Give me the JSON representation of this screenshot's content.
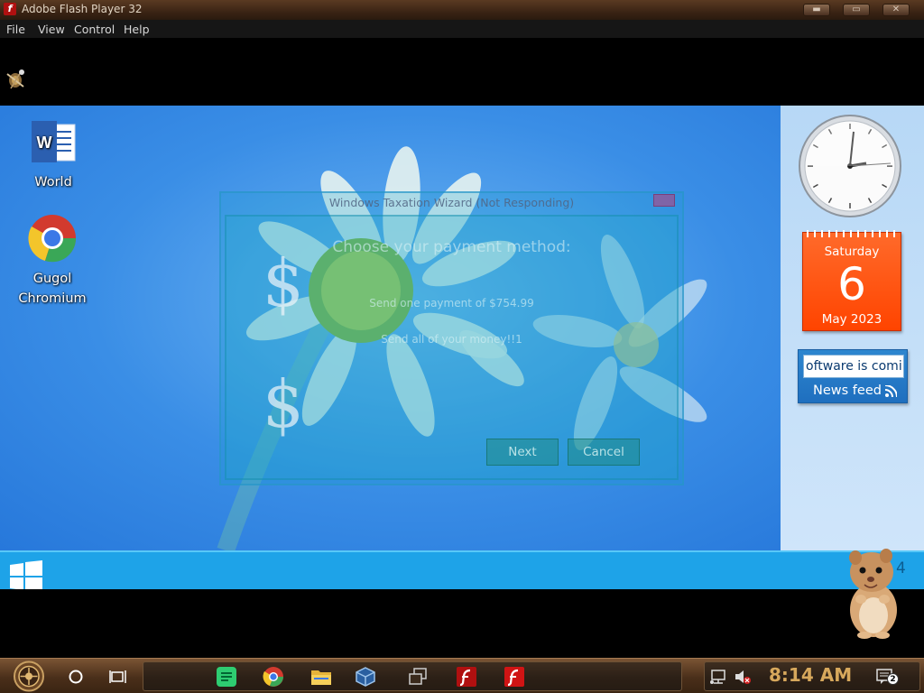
{
  "window": {
    "title": "Adobe Flash Player 32"
  },
  "menu": {
    "file": "File",
    "view": "View",
    "control": "Control",
    "help": "Help"
  },
  "desktop_icons": [
    {
      "label": "World",
      "icon": "word-document-icon"
    },
    {
      "label": "Gugol",
      "label2": "Chromium",
      "icon": "chromium-icon"
    }
  ],
  "wizard": {
    "title": "Windows Taxation Wizard (Not Responding)",
    "heading": "Choose your payment method:",
    "option1": "Send one payment of $754.99",
    "option2": "Send all of your money!!1",
    "symbol": "$",
    "next_label": "Next",
    "cancel_label": "Cancel"
  },
  "gadgets": {
    "calendar": {
      "day": "Saturday",
      "date": "6",
      "month": "May 2023"
    },
    "newsfeed": {
      "ticker": "oftware is comi",
      "label": "News feed"
    }
  },
  "strip": {
    "number": "4"
  },
  "taskbar": {
    "time": "8:14 AM",
    "notifications": "2",
    "accent": "#d7a85c"
  }
}
